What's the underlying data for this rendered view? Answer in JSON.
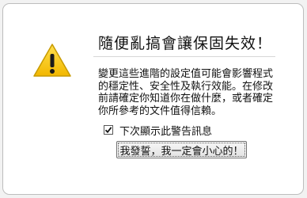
{
  "dialog": {
    "title": "隨便亂搞會讓保固失效！",
    "message": "變更這些進階的設定值可能會影響程式的穩定性、安全性及執行效能。在修改前請確定你知道你在做什麼，或者確定你所參考的文件值得信賴。",
    "checkbox_label": "下次顯示此警告訊息",
    "checkbox_checked": true,
    "confirm_label": "我發誓，我一定會小心的！",
    "icon": "warning-icon",
    "colors": {
      "warning_fill": "#f5c400",
      "warning_outline": "#c79a00",
      "button_border": "#707070"
    }
  }
}
